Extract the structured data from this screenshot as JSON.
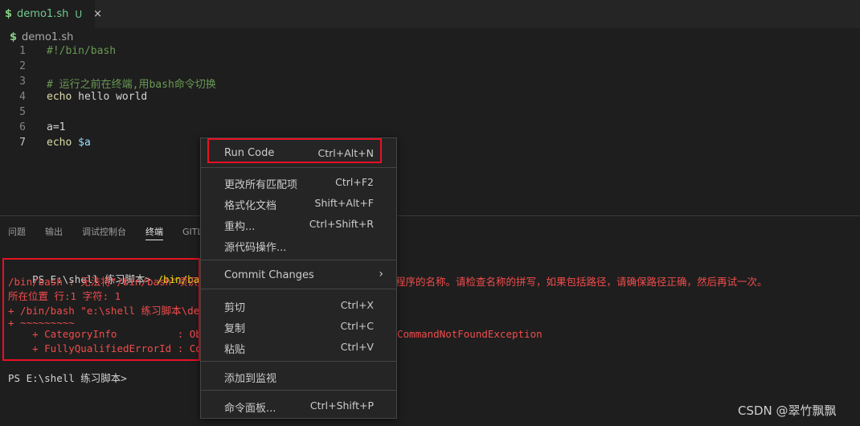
{
  "tab": {
    "filename": "demo1.sh",
    "status": "U",
    "close_icon": "×"
  },
  "breadcrumb": {
    "icon": "$",
    "file": "demo1.sh"
  },
  "editor": {
    "lines": [
      {
        "num": "1",
        "text": "#!/bin/bash"
      },
      {
        "num": "2",
        "text": ""
      },
      {
        "num": "3",
        "text": "# 运行之前在终端,用bash命令切换"
      },
      {
        "num": "4",
        "kw": "echo",
        "rest": " hello world"
      },
      {
        "num": "5",
        "text": ""
      },
      {
        "num": "6",
        "text": "a=1"
      },
      {
        "num": "7",
        "kw": "echo",
        "var": " $a"
      }
    ]
  },
  "panel_tabs": [
    "问题",
    "输出",
    "调试控制台",
    "终端",
    "GITL"
  ],
  "terminal": {
    "line1_prompt": "PS E:\\shell 练习脚本> ",
    "line1_cmd": "/bin/bash \"e",
    "line2_left": "/bin/bash : 无法将\"/bin/bash\"项识别",
    "line2_right": "程序的名称。请检查名称的拼写，如果包括路径，请确保路径正确，然后再试一次。",
    "line3": "所在位置 行:1 字符: 1",
    "line4": "+ /bin/bash \"e:\\shell 练习脚本\\dem",
    "line5": "+ ~~~~~~~~~",
    "line6_left": "    + CategoryInfo          : Obje",
    "line6_right": "CommandNotFoundException",
    "line7_left": "    + FullyQualifiedErrorId : Comm",
    "line8": "PS E:\\shell 练习脚本> "
  },
  "context_menu": {
    "items": [
      {
        "label": "Run Code",
        "shortcut": "Ctrl+Alt+N"
      },
      {
        "label": "更改所有匹配项",
        "shortcut": "Ctrl+F2"
      },
      {
        "label": "格式化文档",
        "shortcut": "Shift+Alt+F"
      },
      {
        "label": "重构...",
        "shortcut": "Ctrl+Shift+R"
      },
      {
        "label": "源代码操作...",
        "shortcut": ""
      },
      {
        "label": "Commit Changes",
        "shortcut": ""
      },
      {
        "label": "剪切",
        "shortcut": "Ctrl+X"
      },
      {
        "label": "复制",
        "shortcut": "Ctrl+C"
      },
      {
        "label": "粘贴",
        "shortcut": "Ctrl+V"
      },
      {
        "label": "添加到监视",
        "shortcut": ""
      },
      {
        "label": "命令面板...",
        "shortcut": "Ctrl+Shift+P"
      }
    ],
    "submenu_arrow": "›"
  },
  "watermark": "CSDN @翠竹飘飘",
  "colors": {
    "accent_red": "#e81123",
    "error_text": "#f14c4c",
    "git_untracked": "#73c991"
  }
}
